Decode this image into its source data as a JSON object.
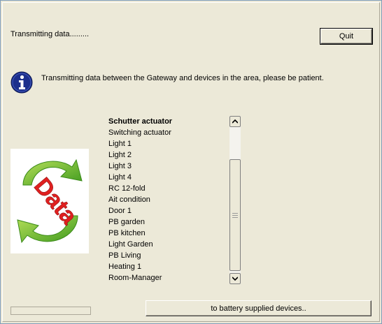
{
  "status": {
    "text": "Transmitting data........."
  },
  "toolbar": {
    "quit_label": "Quit"
  },
  "info": {
    "message": "Transmitting data between the Gateway and devices in the area, please be patient."
  },
  "logo": {
    "text": "Data"
  },
  "devices": {
    "items": [
      "Schutter actuator",
      "Switching actuator",
      "Light 1",
      "Light 2",
      "Light 3",
      "Light 4",
      "RC 12-fold",
      "Ait condition",
      "Door 1",
      "PB garden",
      "PB kitchen",
      "Light Garden",
      "PB Living",
      "Heating 1",
      "Room-Manager"
    ],
    "selected_index": 0
  },
  "footer": {
    "battery_button_label": "to battery supplied devices.."
  },
  "progress": {
    "value": 0
  },
  "colors": {
    "info_blue": "#1c2f8c",
    "arrow_green": "#6fba2a",
    "data_red": "#e02020"
  }
}
